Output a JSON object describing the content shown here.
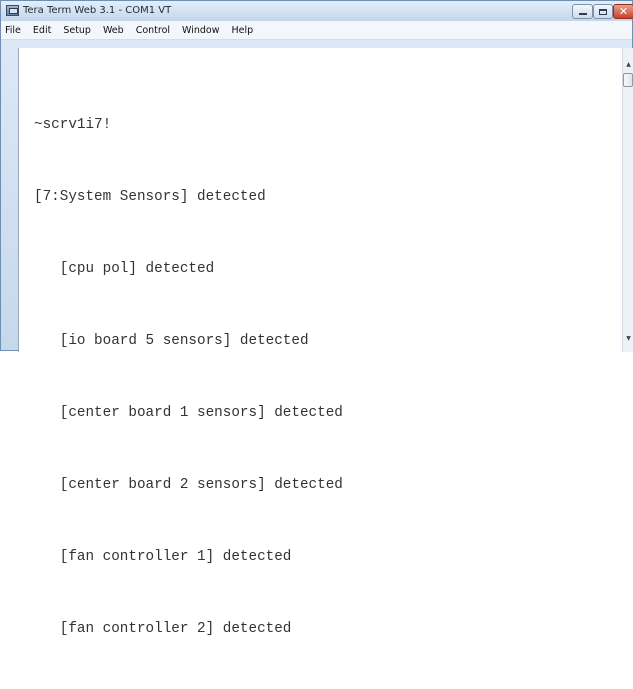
{
  "window": {
    "title": "Tera Term Web 3.1 - COM1 VT",
    "controls": {
      "minimize": "—",
      "maximize": "□",
      "close": "✕"
    }
  },
  "menu": [
    "File",
    "Edit",
    "Setup",
    "Web",
    "Control",
    "Window",
    "Help"
  ],
  "terminal": {
    "lines": [
      "~scrv1i7!",
      "[7:System Sensors] detected",
      "   [cpu pol] detected",
      "   [io board 5 sensors] detected",
      "   [center board 1 sensors] detected",
      "   [center board 2 sensors] detected",
      "   [fan controller 1] detected",
      "   [fan controller 2] detected"
    ]
  },
  "scrollbar": {
    "up": "▲",
    "down": "▼"
  },
  "icons": {
    "app": "teraterm-app-icon"
  },
  "colors": {
    "titlebar": "#c5d6ea",
    "close_button": "#c9422a",
    "terminal_background": "#ffffff",
    "terminal_text": "#333333"
  }
}
